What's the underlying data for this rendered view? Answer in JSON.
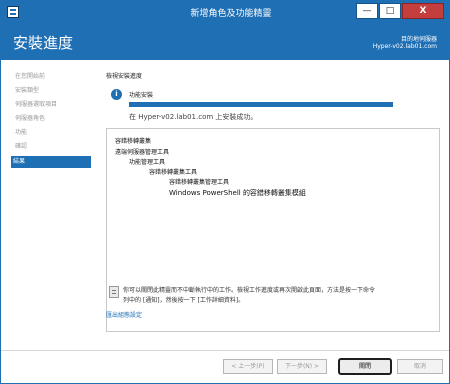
{
  "window": {
    "title": "新增角色及功能精靈",
    "controls": {
      "minimize": "—",
      "maximize": "□",
      "close": "X"
    }
  },
  "header": {
    "page_title": "安裝進度",
    "server_label": "目的地伺服器",
    "server_name": "Hyper-v02.lab01.com"
  },
  "sidebar": {
    "items": [
      {
        "label": "在您開始前"
      },
      {
        "label": "安裝類型"
      },
      {
        "label": "伺服器選取項目"
      },
      {
        "label": "伺服器角色"
      },
      {
        "label": "功能"
      },
      {
        "label": "確認"
      },
      {
        "label": "結果"
      }
    ],
    "active_index": 6
  },
  "content": {
    "section_label": "檢視安裝進度",
    "status_icon": "info-icon",
    "status_title": "功能安裝",
    "progress": 1.0,
    "status_message": "在 Hyper-v02.lab01.com 上安裝成功。",
    "results": [
      {
        "level": 0,
        "text": "容錯移轉叢集"
      },
      {
        "level": 0,
        "text": "遠端伺服器管理工具"
      },
      {
        "level": 1,
        "text": "功能管理工具"
      },
      {
        "level": 2,
        "text": "容錯移轉叢集工具"
      },
      {
        "level": 3,
        "text": "容錯移轉叢集管理工具"
      },
      {
        "level": 3,
        "text": "Windows PowerShell 的容錯移轉叢集模組"
      }
    ],
    "note_line1": "你可以關閉此精靈而不中斷執行中的工作。檢視工作進度或再次開啟此頁面，方法是按一下命令",
    "note_line2": "列中的 [通知]，然後按一下 [工作詳細資料]。",
    "export_link": "匯出組態設定"
  },
  "footer": {
    "prev": "< 上一步(P)",
    "next": "下一步(N) >",
    "close": "關閉",
    "cancel": "取消"
  },
  "colors": {
    "accent": "#1f6fb5",
    "progress": "#1f6fb5"
  }
}
